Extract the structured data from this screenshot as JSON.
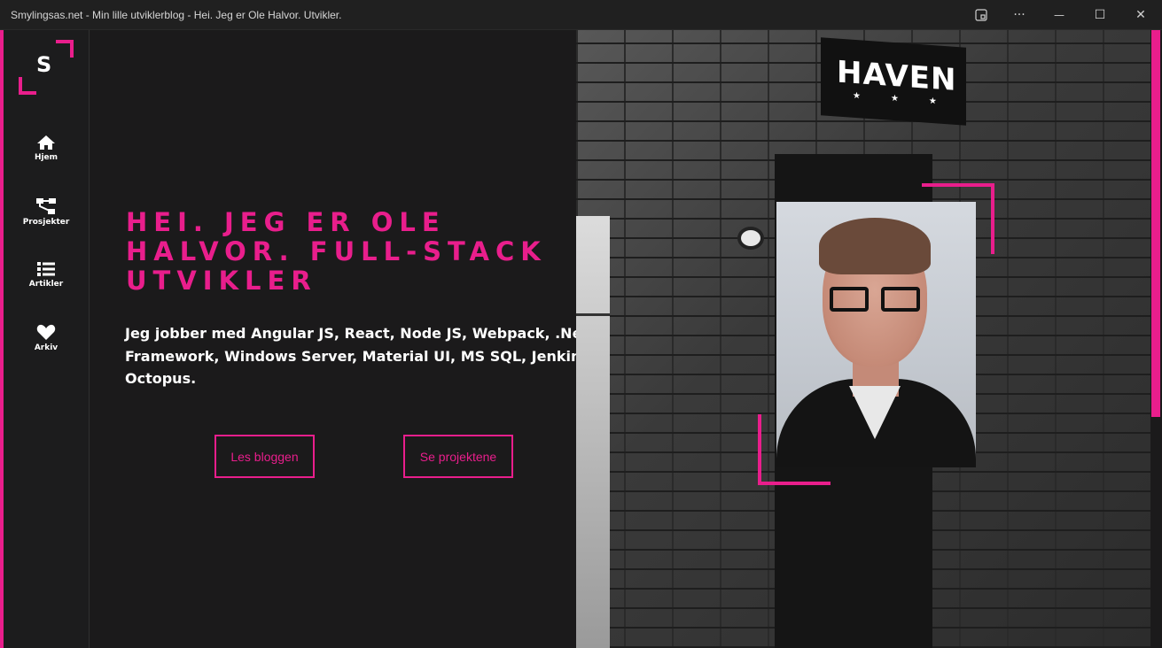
{
  "window": {
    "title": "Smylingsas.net - Min lille utviklerblog - Hei. Jeg er Ole Halvor. Utvikler.",
    "controls": {
      "app_icon": "app-view-icon",
      "more": "···",
      "minimize": "—",
      "maximize": "☐",
      "close": "✕"
    }
  },
  "sidebar": {
    "logo_letter": "S",
    "items": [
      {
        "label": "Hjem",
        "icon": "home-icon"
      },
      {
        "label": "Prosjekter",
        "icon": "sitemap-icon"
      },
      {
        "label": "Artikler",
        "icon": "list-icon"
      },
      {
        "label": "Arkiv",
        "icon": "heart-icon"
      }
    ]
  },
  "hero": {
    "headline_lines": [
      "Hei. Jeg er Ole",
      "Halvor. Full-stack",
      "utvikler"
    ],
    "intro_lines": [
      "Jeg jobber med Angular JS, React, Node JS, Webpack, .Net",
      "Framework, Windows Server, Material UI, MS SQL, Jenkins og",
      "Octopus."
    ],
    "buttons": {
      "blog": "Les bloggen",
      "projects": "Se projektene"
    },
    "sign_text": "HAVEN",
    "sign_stars": "★★★"
  },
  "colors": {
    "accent": "#e91e8c",
    "background": "#1b1a1b",
    "sidebar": "#1c1c1d",
    "text": "#ffffff"
  }
}
